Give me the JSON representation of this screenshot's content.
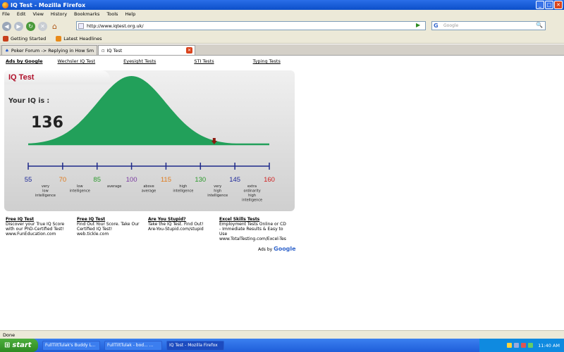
{
  "window": {
    "title": "IQ Test - Mozilla Firefox",
    "minimize": "_",
    "maximize": "□",
    "close": "✕"
  },
  "menu": [
    "File",
    "Edit",
    "View",
    "History",
    "Bookmarks",
    "Tools",
    "Help"
  ],
  "nav": {
    "url": "http://www.iqtest.org.uk/",
    "search_placeholder": "Google"
  },
  "bookmarks": [
    "Getting Started",
    "Latest Headlines"
  ],
  "tabs": [
    {
      "label": "Poker Forum -> Replying in How Smart..."
    },
    {
      "label": "IQ Test"
    }
  ],
  "adlinks": [
    "Ads by Google",
    "Wechsler IQ Test",
    "Eyesight Tests",
    "STI Tests",
    "Typing Tests"
  ],
  "iq_panel": {
    "title": "IQ Test",
    "your_iq_label": "Your IQ is :",
    "score": "136",
    "score_value": 136,
    "ticks": [
      {
        "value": "55",
        "color": "#1f2a9a",
        "desc": [
          "very",
          "low",
          "intelligence"
        ]
      },
      {
        "value": "70",
        "color": "#e07a1a",
        "desc": [
          "low",
          "intelligence"
        ]
      },
      {
        "value": "85",
        "color": "#2b9a2b",
        "desc": [
          "average"
        ]
      },
      {
        "value": "100",
        "color": "#7a3aa0",
        "desc": [
          "above",
          "average"
        ]
      },
      {
        "value": "115",
        "color": "#e07a1a",
        "desc": [
          "high",
          "intelligence"
        ]
      },
      {
        "value": "130",
        "color": "#2b9a2b",
        "desc": [
          "very",
          "high",
          "intelligence"
        ]
      },
      {
        "value": "145",
        "color": "#1f2a9a",
        "desc": [
          "extra",
          "ordinarity",
          "high",
          "intelligence"
        ]
      },
      {
        "value": "160",
        "color": "#d02020",
        "desc": []
      }
    ],
    "colors": {
      "curve": "#22a05a",
      "axis": "#1f2a8a",
      "baseline": "#22a05a",
      "marker": "#8b1a10"
    }
  },
  "ads": [
    {
      "heading": "Free IQ Test",
      "lines": [
        "Discover your True IQ Score",
        "with our PhD-Certified Test!",
        "www.FunEducation.com"
      ]
    },
    {
      "heading": "Free IQ Test",
      "lines": [
        "Find Out Your Score. Take Our",
        "Certified IQ Test!",
        "web.tickle.com"
      ]
    },
    {
      "heading": "Are You Stupid?",
      "lines": [
        "Take the IQ Test. Find Out!",
        "Are-You-Stupid.com/stupid"
      ]
    },
    {
      "heading": "Excel Skills Tests",
      "lines": [
        "Employment Tests Online or CD",
        "- Immediate Results & Easy to",
        "Use",
        "www.TotalTesting.com/Excel-Tes"
      ]
    }
  ],
  "ads_by": {
    "prefix": "Ads by",
    "brand": "Google"
  },
  "status": "Done",
  "taskbar": {
    "start": "start",
    "items": [
      "FullTiltTulak's Buddy L...",
      "FullTiltTulak - bod... ...",
      "IQ Test - Mozilla Firefox"
    ],
    "clock": "11:40 AM"
  }
}
